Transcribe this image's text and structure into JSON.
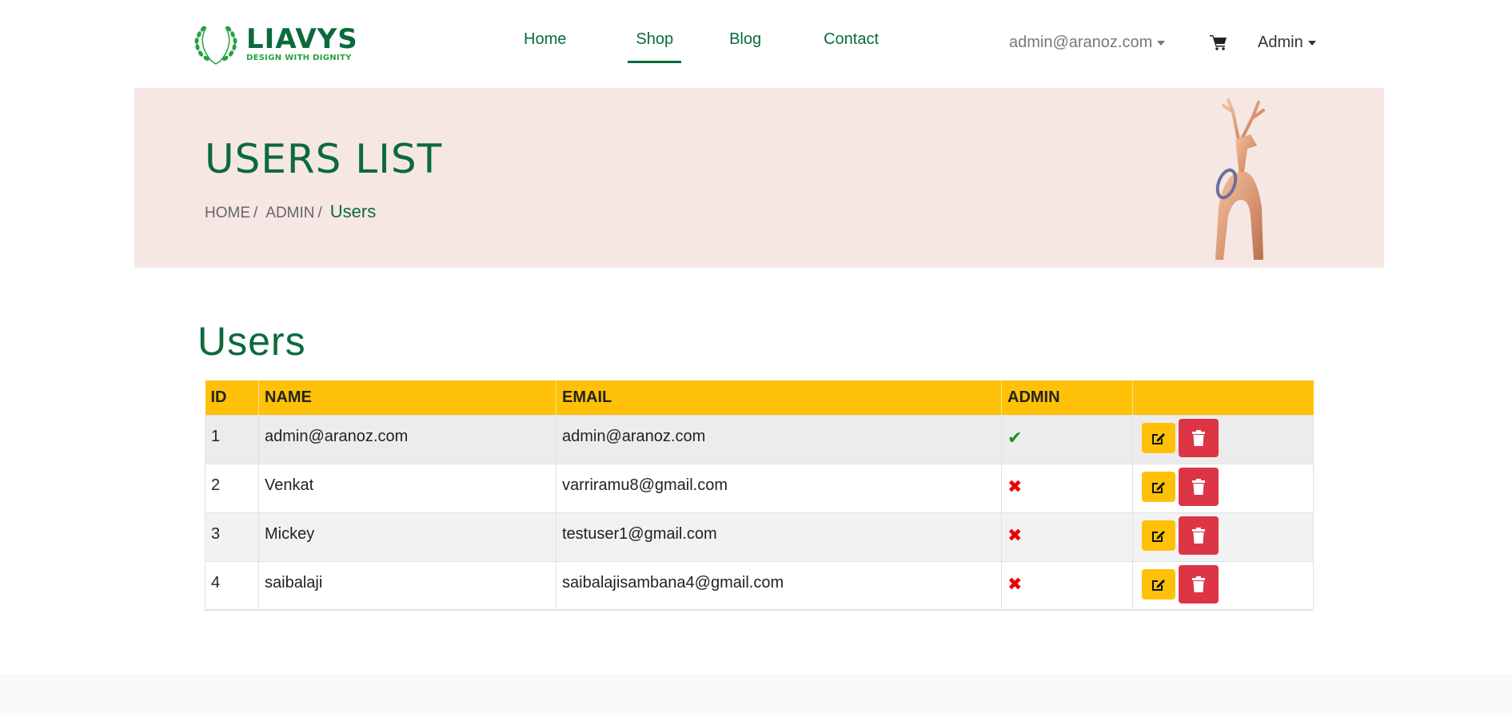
{
  "brand": {
    "name": "LIAVYS",
    "tagline": "DESIGN WITH DIGNITY",
    "color": "#0b6b3a"
  },
  "nav": [
    {
      "label": "Home",
      "active": false
    },
    {
      "label": "Shop",
      "active": true
    },
    {
      "label": "Blog",
      "active": false
    },
    {
      "label": "Contact",
      "active": false
    }
  ],
  "user_menu": {
    "email": "admin@aranoz.com",
    "cart_icon": "cart-icon",
    "admin_label": "Admin"
  },
  "banner": {
    "title": "USERS LIST",
    "breadcrumb": [
      "HOME",
      "ADMIN",
      "Users"
    ],
    "image": "deer-figurine"
  },
  "page": {
    "title": "Users"
  },
  "table": {
    "headers": [
      "ID",
      "NAME",
      "EMAIL",
      "ADMIN",
      ""
    ],
    "rows": [
      {
        "id": "1",
        "name": "admin@aranoz.com",
        "email": "admin@aranoz.com",
        "admin": true
      },
      {
        "id": "2",
        "name": "Venkat",
        "email": "varriramu8@gmail.com",
        "admin": false
      },
      {
        "id": "3",
        "name": "Mickey",
        "email": "testuser1@gmail.com",
        "admin": false
      },
      {
        "id": "4",
        "name": "saibalaji",
        "email": "saibalajisambana4@gmail.com",
        "admin": false
      }
    ],
    "admin_true_icon": "check-icon",
    "admin_false_icon": "cross-icon",
    "edit_icon": "edit-icon",
    "delete_icon": "trash-icon"
  },
  "colors": {
    "accent": "#ffc107",
    "danger": "#dc3545",
    "banner_bg": "#f6e7e4"
  }
}
